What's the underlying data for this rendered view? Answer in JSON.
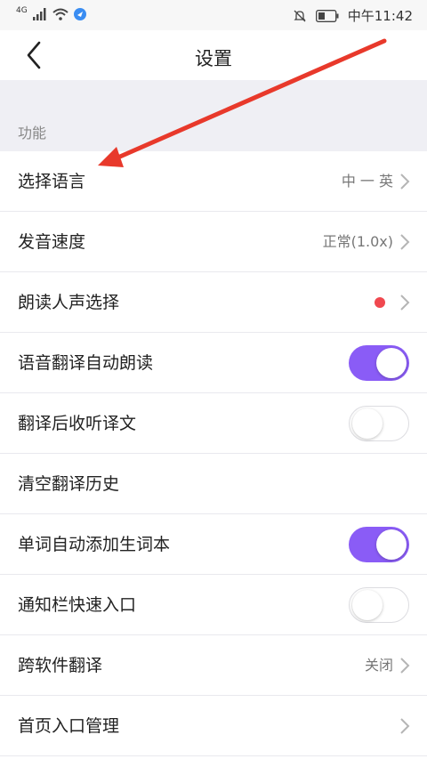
{
  "status_bar": {
    "network": "4G",
    "time": "中午11:42"
  },
  "nav": {
    "title": "设置"
  },
  "section": {
    "label": "功能"
  },
  "rows": [
    {
      "label": "选择语言",
      "value": "中 一 英"
    },
    {
      "label": "发音速度",
      "value": "正常(1.0x)"
    },
    {
      "label": "朗读人声选择"
    },
    {
      "label": "语音翻译自动朗读",
      "toggle": "on"
    },
    {
      "label": "翻译后收听译文",
      "toggle": "off"
    },
    {
      "label": "清空翻译历史"
    },
    {
      "label": "单词自动添加生词本",
      "toggle": "on"
    },
    {
      "label": "通知栏快速入口",
      "toggle": "off"
    },
    {
      "label": "跨软件翻译",
      "value": "关闭"
    },
    {
      "label": "首页入口管理"
    }
  ],
  "colors": {
    "accent": "#8a5cf6",
    "dot": "#f0484f",
    "annotation_arrow": "#e8392b"
  }
}
